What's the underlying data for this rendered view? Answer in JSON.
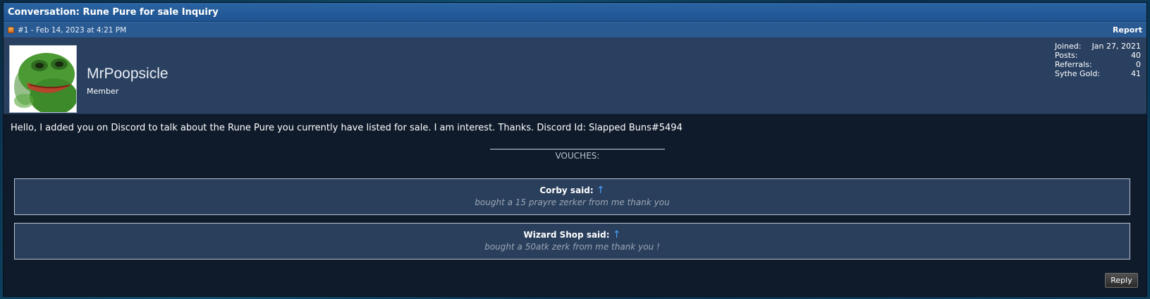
{
  "thread": {
    "title": "Conversation: Rune Pure for sale Inquiry"
  },
  "post": {
    "meta": "#1 - Feb 14, 2023 at 4:21 PM",
    "report_label": "Report",
    "message": "Hello, I added you on Discord to talk about the Rune Pure you currently have listed for sale. I am interest. Thanks. Discord Id: Slapped Buns#5494"
  },
  "user": {
    "name": "MrPoopsicle",
    "title": "Member",
    "avatar_icon": "pepe-frog-avatar",
    "stats": [
      {
        "label": "Joined:",
        "value": "Jan 27, 2021"
      },
      {
        "label": "Posts:",
        "value": "40"
      },
      {
        "label": "Referrals:",
        "value": "0"
      },
      {
        "label": "Sythe Gold:",
        "value": "41"
      }
    ]
  },
  "signature": {
    "heading": "VOUCHES:",
    "vouches": [
      {
        "author": "Corby said:",
        "arrow": "↑",
        "text": "bought a 15 prayre zerker from me thank you"
      },
      {
        "author": "Wizard Shop said:",
        "arrow": "↑",
        "text": "bought a 50atk zerk from me thank you !"
      }
    ]
  },
  "actions": {
    "reply_label": "Reply"
  },
  "colors": {
    "title_bar": "#1f5390",
    "user_bar": "#2a4060",
    "body_bg": "#0f1b2b",
    "quote_bg": "#2a3f5c",
    "arrow_link": "#4aa3ff"
  }
}
